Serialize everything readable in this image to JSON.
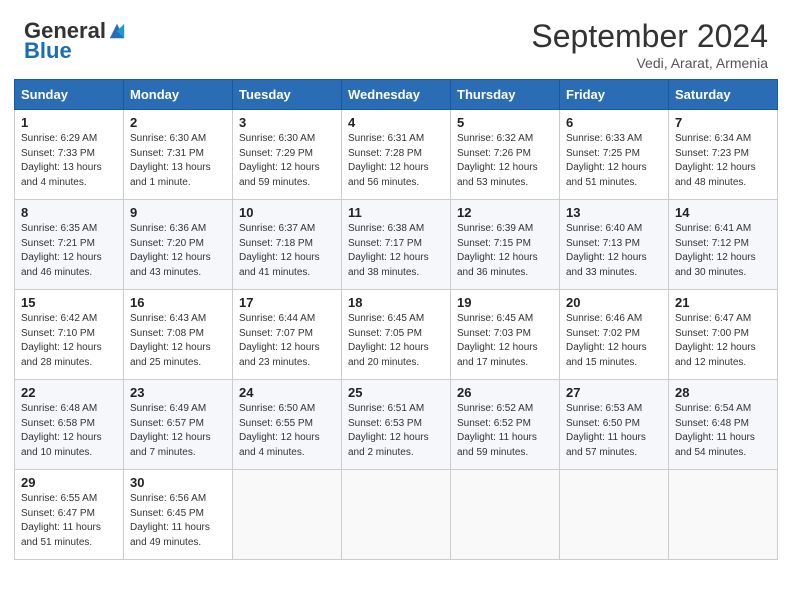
{
  "header": {
    "logo_general": "General",
    "logo_blue": "Blue",
    "title": "September 2024",
    "location": "Vedi, Ararat, Armenia"
  },
  "days_of_week": [
    "Sunday",
    "Monday",
    "Tuesday",
    "Wednesday",
    "Thursday",
    "Friday",
    "Saturday"
  ],
  "weeks": [
    [
      {
        "day": "1",
        "sunrise": "Sunrise: 6:29 AM",
        "sunset": "Sunset: 7:33 PM",
        "daylight": "Daylight: 13 hours and 4 minutes."
      },
      {
        "day": "2",
        "sunrise": "Sunrise: 6:30 AM",
        "sunset": "Sunset: 7:31 PM",
        "daylight": "Daylight: 13 hours and 1 minute."
      },
      {
        "day": "3",
        "sunrise": "Sunrise: 6:30 AM",
        "sunset": "Sunset: 7:29 PM",
        "daylight": "Daylight: 12 hours and 59 minutes."
      },
      {
        "day": "4",
        "sunrise": "Sunrise: 6:31 AM",
        "sunset": "Sunset: 7:28 PM",
        "daylight": "Daylight: 12 hours and 56 minutes."
      },
      {
        "day": "5",
        "sunrise": "Sunrise: 6:32 AM",
        "sunset": "Sunset: 7:26 PM",
        "daylight": "Daylight: 12 hours and 53 minutes."
      },
      {
        "day": "6",
        "sunrise": "Sunrise: 6:33 AM",
        "sunset": "Sunset: 7:25 PM",
        "daylight": "Daylight: 12 hours and 51 minutes."
      },
      {
        "day": "7",
        "sunrise": "Sunrise: 6:34 AM",
        "sunset": "Sunset: 7:23 PM",
        "daylight": "Daylight: 12 hours and 48 minutes."
      }
    ],
    [
      {
        "day": "8",
        "sunrise": "Sunrise: 6:35 AM",
        "sunset": "Sunset: 7:21 PM",
        "daylight": "Daylight: 12 hours and 46 minutes."
      },
      {
        "day": "9",
        "sunrise": "Sunrise: 6:36 AM",
        "sunset": "Sunset: 7:20 PM",
        "daylight": "Daylight: 12 hours and 43 minutes."
      },
      {
        "day": "10",
        "sunrise": "Sunrise: 6:37 AM",
        "sunset": "Sunset: 7:18 PM",
        "daylight": "Daylight: 12 hours and 41 minutes."
      },
      {
        "day": "11",
        "sunrise": "Sunrise: 6:38 AM",
        "sunset": "Sunset: 7:17 PM",
        "daylight": "Daylight: 12 hours and 38 minutes."
      },
      {
        "day": "12",
        "sunrise": "Sunrise: 6:39 AM",
        "sunset": "Sunset: 7:15 PM",
        "daylight": "Daylight: 12 hours and 36 minutes."
      },
      {
        "day": "13",
        "sunrise": "Sunrise: 6:40 AM",
        "sunset": "Sunset: 7:13 PM",
        "daylight": "Daylight: 12 hours and 33 minutes."
      },
      {
        "day": "14",
        "sunrise": "Sunrise: 6:41 AM",
        "sunset": "Sunset: 7:12 PM",
        "daylight": "Daylight: 12 hours and 30 minutes."
      }
    ],
    [
      {
        "day": "15",
        "sunrise": "Sunrise: 6:42 AM",
        "sunset": "Sunset: 7:10 PM",
        "daylight": "Daylight: 12 hours and 28 minutes."
      },
      {
        "day": "16",
        "sunrise": "Sunrise: 6:43 AM",
        "sunset": "Sunset: 7:08 PM",
        "daylight": "Daylight: 12 hours and 25 minutes."
      },
      {
        "day": "17",
        "sunrise": "Sunrise: 6:44 AM",
        "sunset": "Sunset: 7:07 PM",
        "daylight": "Daylight: 12 hours and 23 minutes."
      },
      {
        "day": "18",
        "sunrise": "Sunrise: 6:45 AM",
        "sunset": "Sunset: 7:05 PM",
        "daylight": "Daylight: 12 hours and 20 minutes."
      },
      {
        "day": "19",
        "sunrise": "Sunrise: 6:45 AM",
        "sunset": "Sunset: 7:03 PM",
        "daylight": "Daylight: 12 hours and 17 minutes."
      },
      {
        "day": "20",
        "sunrise": "Sunrise: 6:46 AM",
        "sunset": "Sunset: 7:02 PM",
        "daylight": "Daylight: 12 hours and 15 minutes."
      },
      {
        "day": "21",
        "sunrise": "Sunrise: 6:47 AM",
        "sunset": "Sunset: 7:00 PM",
        "daylight": "Daylight: 12 hours and 12 minutes."
      }
    ],
    [
      {
        "day": "22",
        "sunrise": "Sunrise: 6:48 AM",
        "sunset": "Sunset: 6:58 PM",
        "daylight": "Daylight: 12 hours and 10 minutes."
      },
      {
        "day": "23",
        "sunrise": "Sunrise: 6:49 AM",
        "sunset": "Sunset: 6:57 PM",
        "daylight": "Daylight: 12 hours and 7 minutes."
      },
      {
        "day": "24",
        "sunrise": "Sunrise: 6:50 AM",
        "sunset": "Sunset: 6:55 PM",
        "daylight": "Daylight: 12 hours and 4 minutes."
      },
      {
        "day": "25",
        "sunrise": "Sunrise: 6:51 AM",
        "sunset": "Sunset: 6:53 PM",
        "daylight": "Daylight: 12 hours and 2 minutes."
      },
      {
        "day": "26",
        "sunrise": "Sunrise: 6:52 AM",
        "sunset": "Sunset: 6:52 PM",
        "daylight": "Daylight: 11 hours and 59 minutes."
      },
      {
        "day": "27",
        "sunrise": "Sunrise: 6:53 AM",
        "sunset": "Sunset: 6:50 PM",
        "daylight": "Daylight: 11 hours and 57 minutes."
      },
      {
        "day": "28",
        "sunrise": "Sunrise: 6:54 AM",
        "sunset": "Sunset: 6:48 PM",
        "daylight": "Daylight: 11 hours and 54 minutes."
      }
    ],
    [
      {
        "day": "29",
        "sunrise": "Sunrise: 6:55 AM",
        "sunset": "Sunset: 6:47 PM",
        "daylight": "Daylight: 11 hours and 51 minutes."
      },
      {
        "day": "30",
        "sunrise": "Sunrise: 6:56 AM",
        "sunset": "Sunset: 6:45 PM",
        "daylight": "Daylight: 11 hours and 49 minutes."
      },
      null,
      null,
      null,
      null,
      null
    ]
  ]
}
